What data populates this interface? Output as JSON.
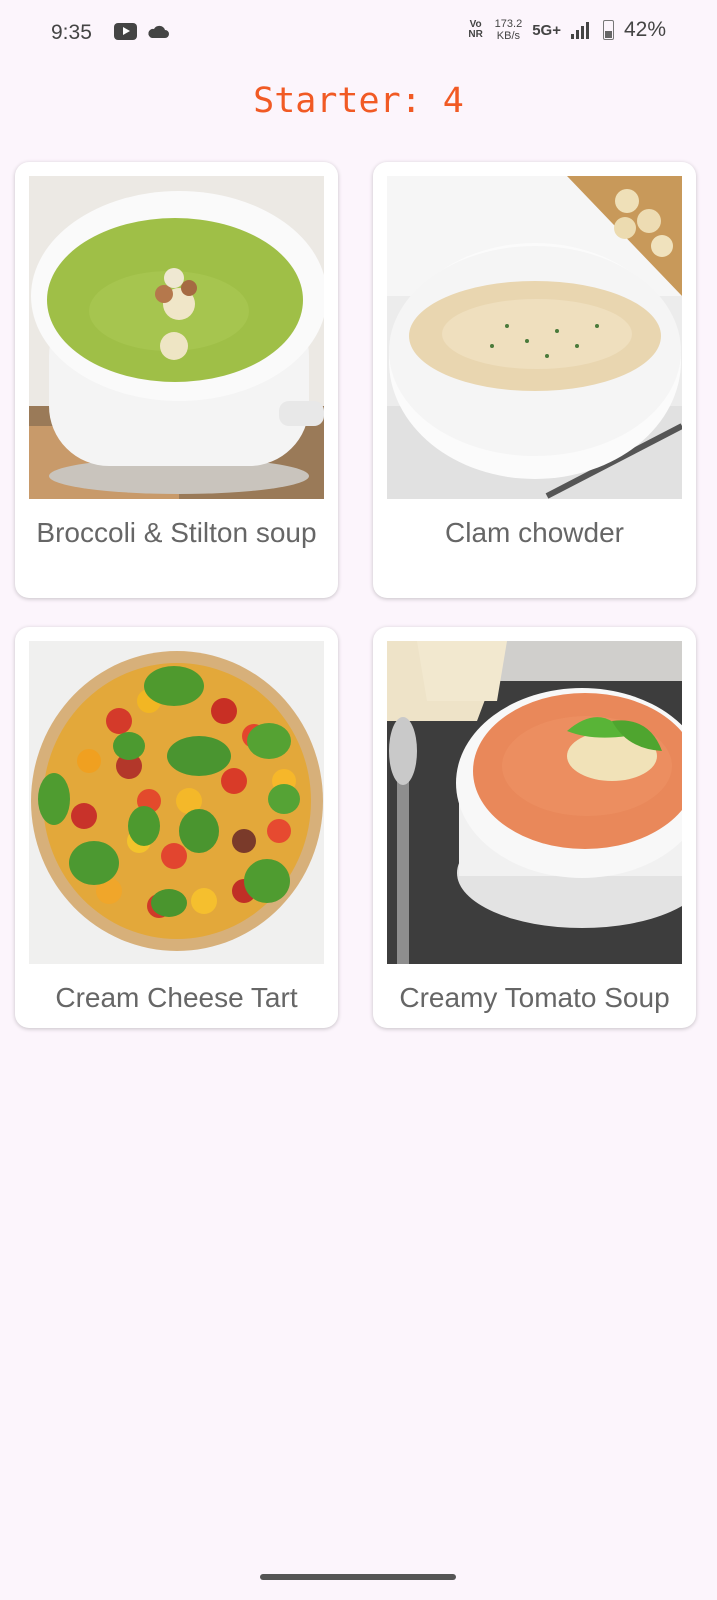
{
  "status_bar": {
    "time": "9:35",
    "network_type": "VoNR",
    "speed_value": "173.2",
    "speed_unit": "KB/s",
    "cellular": "5G+",
    "battery": "42%",
    "icons": [
      "youtube-icon",
      "cloud-icon",
      "signal-icon",
      "battery-icon"
    ]
  },
  "page": {
    "title": "Starter: 4"
  },
  "recipes": [
    {
      "name": "Broccoli & Stilton soup",
      "image": "broccoli-soup-photo"
    },
    {
      "name": "Clam chowder",
      "image": "clam-chowder-photo"
    },
    {
      "name": "Cream Cheese Tart",
      "image": "tomato-tart-photo"
    },
    {
      "name": "Creamy Tomato Soup",
      "image": "tomato-soup-photo"
    }
  ],
  "colors": {
    "accent": "#f15a24",
    "background": "#fcf5fc",
    "card": "#ffffff",
    "label": "#666666"
  }
}
